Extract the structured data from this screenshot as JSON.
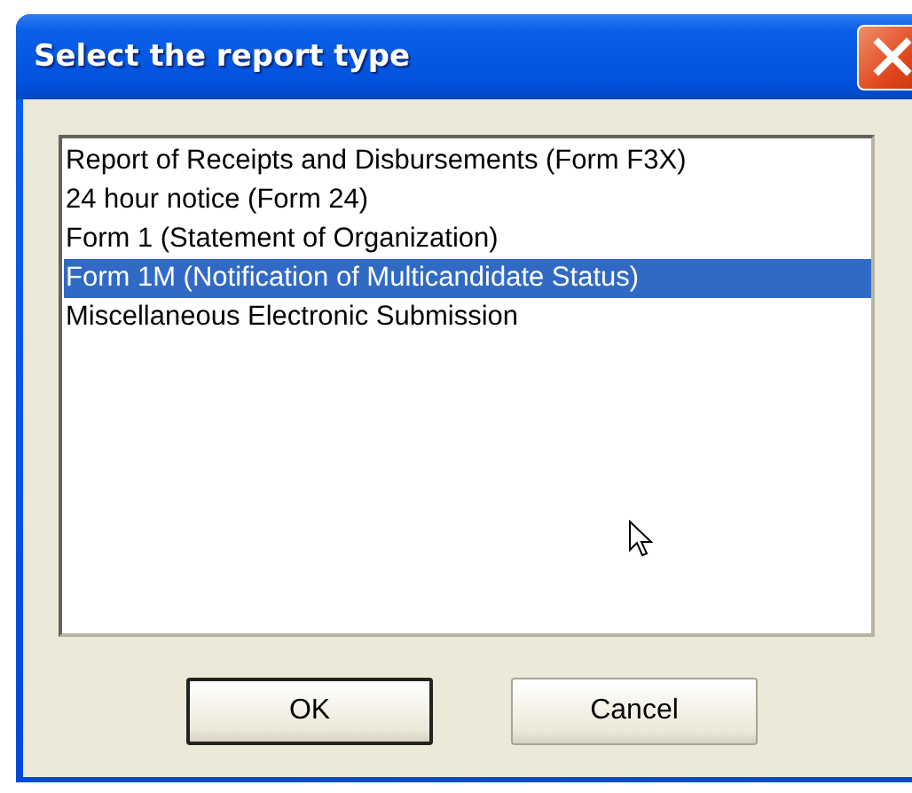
{
  "window": {
    "title": "Select the report type"
  },
  "report_types": [
    {
      "label": "Report of Receipts and Disbursements (Form F3X)",
      "selected": false
    },
    {
      "label": "24 hour notice (Form 24)",
      "selected": false
    },
    {
      "label": "Form 1 (Statement of Organization)",
      "selected": false
    },
    {
      "label": "Form 1M (Notification of Multicandidate Status)",
      "selected": true
    },
    {
      "label": "Miscellaneous Electronic Submission",
      "selected": false
    }
  ],
  "buttons": [
    {
      "label": "OK",
      "default": true
    },
    {
      "label": "Cancel",
      "default": false
    }
  ]
}
